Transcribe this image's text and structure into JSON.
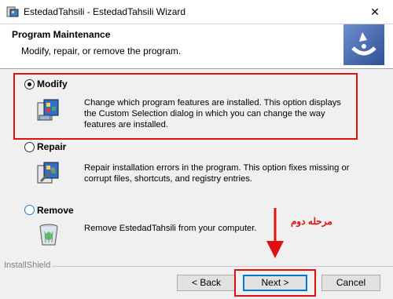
{
  "window": {
    "title": "EstedadTahsili - EstedadTahsili Wizard",
    "close_glyph": "✕"
  },
  "header": {
    "title": "Program Maintenance",
    "subtitle": "Modify, repair, or remove the program."
  },
  "options": [
    {
      "label": "Modify",
      "selected": true,
      "description": "Change which program features are installed. This option displays the Custom Selection dialog in which you can change the way features are installed."
    },
    {
      "label": "Repair",
      "selected": false,
      "description": "Repair installation errors in the program. This option fixes missing or corrupt files, shortcuts, and registry entries."
    },
    {
      "label": "Remove",
      "selected": false,
      "description": "Remove EstedadTahsili from your computer."
    }
  ],
  "footer": {
    "brand": "InstallShield"
  },
  "buttons": {
    "back": "< Back",
    "next": "Next >",
    "cancel": "Cancel"
  },
  "annotation": {
    "text": "مرحله دوم"
  },
  "colors": {
    "highlight": "#e01010",
    "header_bg": "#ffffff",
    "dialog_bg": "#f0f0f0",
    "logo_bg": "#4a6fb5"
  }
}
